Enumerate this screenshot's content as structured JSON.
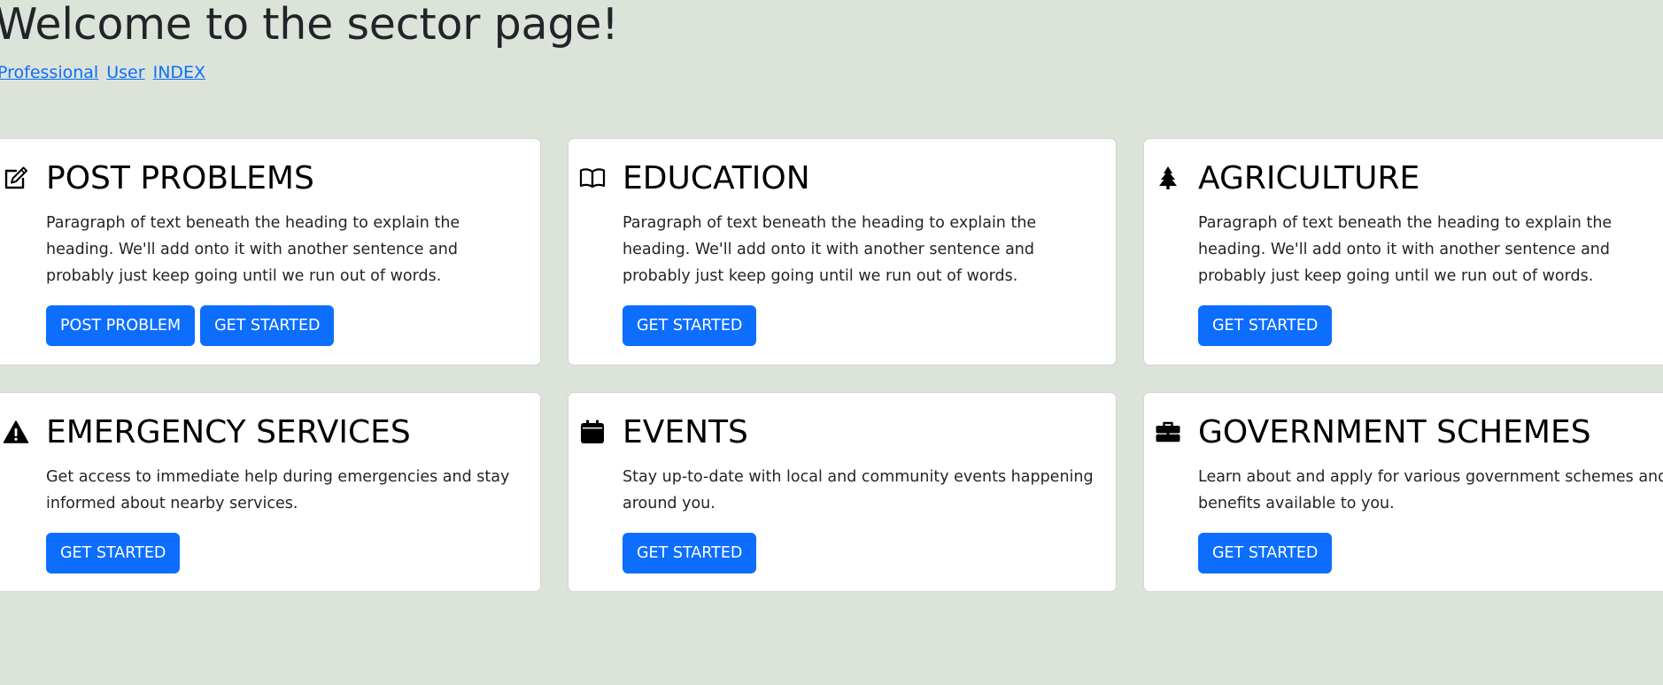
{
  "page": {
    "title": "Welcome to the sector page!"
  },
  "nav": {
    "links": [
      "Professional",
      "User",
      "INDEX"
    ]
  },
  "cards": [
    {
      "icon": "pencil-square-icon",
      "title": "POST PROBLEMS",
      "text": "Paragraph of text beneath the heading to explain the heading. We'll add onto it with another sentence and probably just keep going until we run out of words.",
      "buttons": [
        "POST PROBLEM",
        "GET STARTED"
      ]
    },
    {
      "icon": "book-icon",
      "title": "EDUCATION",
      "text": "Paragraph of text beneath the heading to explain the heading. We'll add onto it with another sentence and probably just keep going until we run out of words.",
      "buttons": [
        "GET STARTED"
      ]
    },
    {
      "icon": "tree-icon",
      "title": "AGRICULTURE",
      "text": "Paragraph of text beneath the heading to explain the heading. We'll add onto it with another sentence and probably just keep going until we run out of words.",
      "buttons": [
        "GET STARTED"
      ]
    },
    {
      "icon": "warning-triangle-icon",
      "title": "EMERGENCY SERVICES",
      "text": "Get access to immediate help during emergencies and stay informed about nearby services.",
      "buttons": [
        "GET STARTED"
      ]
    },
    {
      "icon": "calendar-icon",
      "title": "EVENTS",
      "text": "Stay up-to-date with local and community events happening around you.",
      "buttons": [
        "GET STARTED"
      ]
    },
    {
      "icon": "briefcase-icon",
      "title": "GOVERNMENT SCHEMES",
      "text": "Learn about and apply for various government schemes and benefits available to you.",
      "buttons": [
        "GET STARTED"
      ]
    }
  ],
  "colors": {
    "background": "#dce3d8",
    "card": "#ffffff",
    "primary": "#0d6efd",
    "link": "#0d6efd",
    "heading": "#212529"
  }
}
